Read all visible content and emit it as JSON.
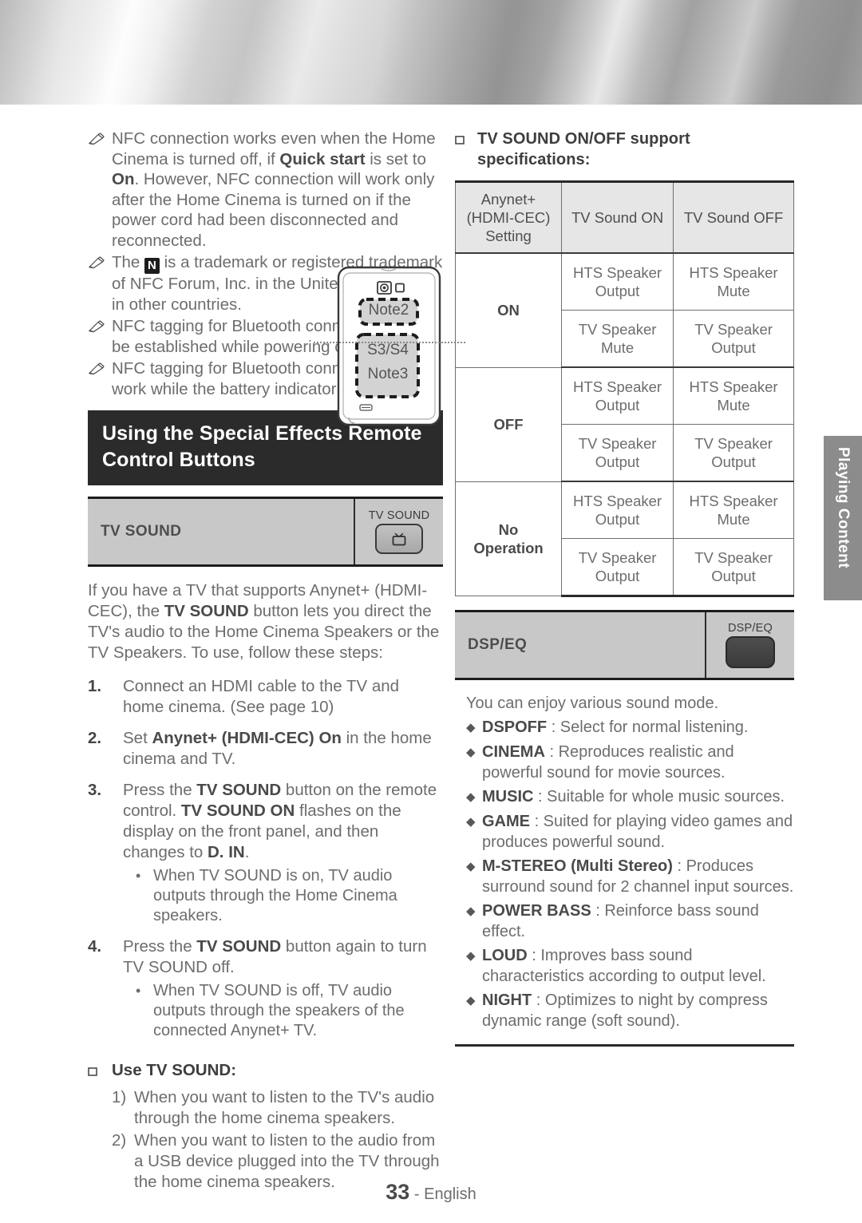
{
  "page": {
    "number": "33",
    "language": "English",
    "side_tab": "Playing Content"
  },
  "left_column": {
    "notes": [
      "NFC connection works even when the Home Cinema is turned off, if **Quick start** is set to **On**. However, NFC connection will work only after the Home Cinema is turned on if the power cord had been disconnected and reconnected.",
      "The [N] is a trademark or registered trademark of NFC Forum, Inc. in the United States and in other countries.",
      "NFC tagging for Bluetooth connection cannot be established while powering on and off.",
      "NFC tagging for Bluetooth connection will not work while the battery indicator is blinking."
    ],
    "phone_diagram": {
      "zone_top_label": "Note2",
      "zone_bottom_label_1": "S3/S4",
      "zone_bottom_label_2": "Note3"
    },
    "section_heading": "Using the Special Effects Remote Control Buttons",
    "tv_sound_bar": {
      "label": "TV SOUND",
      "key_name": "TV SOUND"
    },
    "intro": "If you have a TV that supports Anynet+ (HDMI-CEC), the TV SOUND button lets you direct the TV's audio to the Home Cinema Speakers or the TV Speakers. To use, follow these steps:",
    "steps": [
      {
        "num": "1.",
        "text": "Connect an HDMI cable to the TV and home cinema. (See page 10)",
        "bullets": []
      },
      {
        "num": "2.",
        "text": "Set Anynet+ (HDMI-CEC) On in the home cinema and TV.",
        "bullets": []
      },
      {
        "num": "3.",
        "text": "Press the TV SOUND button on the remote control. TV SOUND ON flashes on the display on the front panel, and then changes to D. IN.",
        "bullets": [
          "When TV SOUND is on, TV audio outputs through the Home Cinema speakers."
        ]
      },
      {
        "num": "4.",
        "text": "Press the TV SOUND button again to turn TV SOUND off.",
        "bullets": [
          "When TV SOUND is off, TV audio outputs through the speakers of the connected Anynet+ TV."
        ]
      }
    ],
    "use_tv_sound": {
      "heading": "Use TV SOUND:",
      "items": [
        {
          "num": "1)",
          "text": "When you want to listen to the TV's audio through the home cinema speakers."
        },
        {
          "num": "2)",
          "text": "When you want to listen to the audio from a USB device plugged into the TV through the home cinema speakers."
        }
      ]
    }
  },
  "right_column": {
    "spec_heading": "TV SOUND ON/OFF support specifications:",
    "spec_table": {
      "headers": [
        "Anynet+ (HDMI-CEC) Setting",
        "TV Sound ON",
        "TV Sound OFF"
      ],
      "header_lines": [
        [
          "Anynet+",
          "(HDMI-CEC)",
          "Setting"
        ],
        [
          "TV Sound ON"
        ],
        [
          "TV Sound OFF"
        ]
      ],
      "rows": [
        {
          "setting": "ON",
          "pairs": [
            {
              "on": [
                "HTS Speaker",
                "Output"
              ],
              "off": [
                "HTS Speaker",
                "Mute"
              ]
            },
            {
              "on": [
                "TV Speaker",
                "Mute"
              ],
              "off": [
                "TV Speaker",
                "Output"
              ]
            }
          ]
        },
        {
          "setting": "OFF",
          "pairs": [
            {
              "on": [
                "HTS Speaker",
                "Output"
              ],
              "off": [
                "HTS Speaker",
                "Mute"
              ]
            },
            {
              "on": [
                "TV Speaker",
                "Output"
              ],
              "off": [
                "TV Speaker",
                "Output"
              ]
            }
          ]
        },
        {
          "setting": "No Operation",
          "setting_lines": [
            "No",
            "Operation"
          ],
          "pairs": [
            {
              "on": [
                "HTS Speaker",
                "Output"
              ],
              "off": [
                "HTS Speaker",
                "Mute"
              ]
            },
            {
              "on": [
                "TV Speaker",
                "Output"
              ],
              "off": [
                "TV Speaker",
                "Output"
              ]
            }
          ]
        }
      ]
    },
    "dsp_bar": {
      "label": "DSP/EQ",
      "key_name": "DSP/EQ"
    },
    "dsp_intro": "You can enjoy various sound mode.",
    "dsp_modes": [
      {
        "name": "DSPOFF",
        "desc": ": Select for normal listening."
      },
      {
        "name": "CINEMA",
        "desc": ": Reproduces realistic and powerful sound for movie sources."
      },
      {
        "name": "MUSIC",
        "desc": ": Suitable for whole music sources."
      },
      {
        "name": "GAME",
        "desc": ": Suited for playing video games and produces powerful sound."
      },
      {
        "name": "M-STEREO (Multi Stereo)",
        "desc": ": Produces surround sound for 2 channel input sources."
      },
      {
        "name": "POWER BASS",
        "desc": ": Reinforce bass sound effect."
      },
      {
        "name": "LOUD",
        "desc": ": Improves bass sound characteristics according to output level."
      },
      {
        "name": "NIGHT",
        "desc": ": Optimizes to night by compress dynamic range (soft sound)."
      }
    ]
  },
  "colors": {
    "heading_bar": "#2b2b2b",
    "button_bar": "#c8c8c8",
    "table_header": "#e6e6e6",
    "side_tab": "#8c8c8c",
    "body_text": "#6d6d6d"
  }
}
